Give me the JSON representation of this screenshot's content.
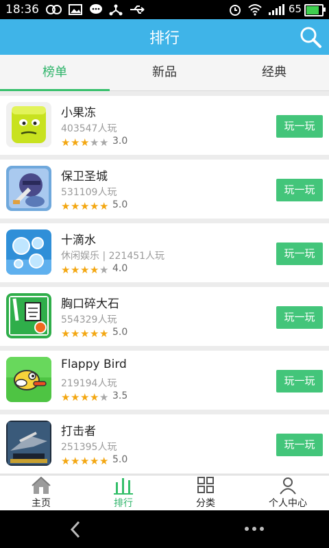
{
  "status_bar": {
    "time": "18:36",
    "battery_percent": "65"
  },
  "header": {
    "title": "排行"
  },
  "tabs": [
    {
      "label": "榜单",
      "active": true
    },
    {
      "label": "新品",
      "active": false
    },
    {
      "label": "经典",
      "active": false
    }
  ],
  "games": [
    {
      "name": "小果冻",
      "plays": "403547人玩",
      "rating": 3.0,
      "score": "3.0",
      "button": "玩一玩"
    },
    {
      "name": "保卫圣城",
      "plays": "531109人玩",
      "rating": 5.0,
      "score": "5.0",
      "button": "玩一玩"
    },
    {
      "name": "十滴水",
      "plays": "休闲娱乐 | 221451人玩",
      "rating": 4.0,
      "score": "4.0",
      "button": "玩一玩"
    },
    {
      "name": "胸口碎大石",
      "plays": "554329人玩",
      "rating": 5.0,
      "score": "5.0",
      "button": "玩一玩"
    },
    {
      "name": "Flappy Bird",
      "plays": "219194人玩",
      "rating": 3.5,
      "score": "3.5",
      "button": "玩一玩"
    },
    {
      "name": "打击者",
      "plays": "251395人玩",
      "rating": 5.0,
      "score": "5.0",
      "button": "玩一玩"
    }
  ],
  "bottom_nav": [
    {
      "label": "主页",
      "icon": "home-icon",
      "active": false
    },
    {
      "label": "排行",
      "icon": "ranking-icon",
      "active": true
    },
    {
      "label": "分类",
      "icon": "grid-icon",
      "active": false
    },
    {
      "label": "个人中心",
      "icon": "person-icon",
      "active": false
    }
  ],
  "colors": {
    "accent": "#3fb4e8",
    "green": "#43c57a",
    "star": "#f3a712"
  }
}
